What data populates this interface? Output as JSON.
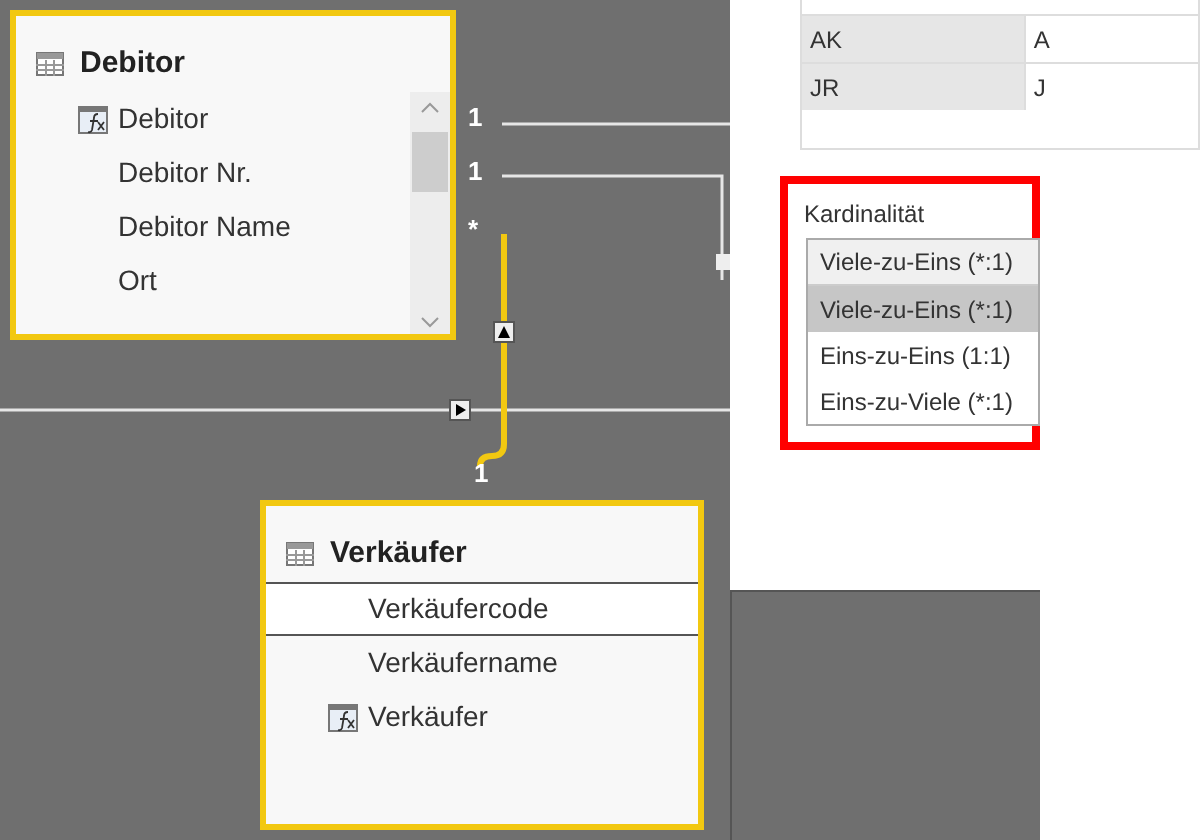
{
  "tables": [
    {
      "name": "Debitor",
      "fields": [
        {
          "name": "Debitor",
          "kind": "measure",
          "selected": false
        },
        {
          "name": "Debitor Nr.",
          "kind": "column",
          "selected": false
        },
        {
          "name": "Debitor Name",
          "kind": "column",
          "selected": false
        },
        {
          "name": "Ort",
          "kind": "column",
          "selected": false
        }
      ]
    },
    {
      "name": "Verkäufer",
      "fields": [
        {
          "name": "Verkäufercode",
          "kind": "column",
          "selected": true
        },
        {
          "name": "Verkäufername",
          "kind": "column",
          "selected": false
        },
        {
          "name": "Verkäufer",
          "kind": "measure",
          "selected": false
        }
      ]
    }
  ],
  "cardinality_marks": [
    "1",
    "1",
    "*",
    "1"
  ],
  "dialog": {
    "table_rows": [
      [
        "AK",
        "A"
      ],
      [
        "JR",
        "J"
      ]
    ],
    "cardinality": {
      "label": "Kardinalität",
      "value": "Viele-zu-Eins (*:1)",
      "options": [
        {
          "label": "Viele-zu-Eins (*:1)",
          "selected": true
        },
        {
          "label": "Eins-zu-Eins (1:1)",
          "selected": false
        },
        {
          "label": "Eins-zu-Viele (*:1)",
          "selected": false
        }
      ]
    }
  }
}
